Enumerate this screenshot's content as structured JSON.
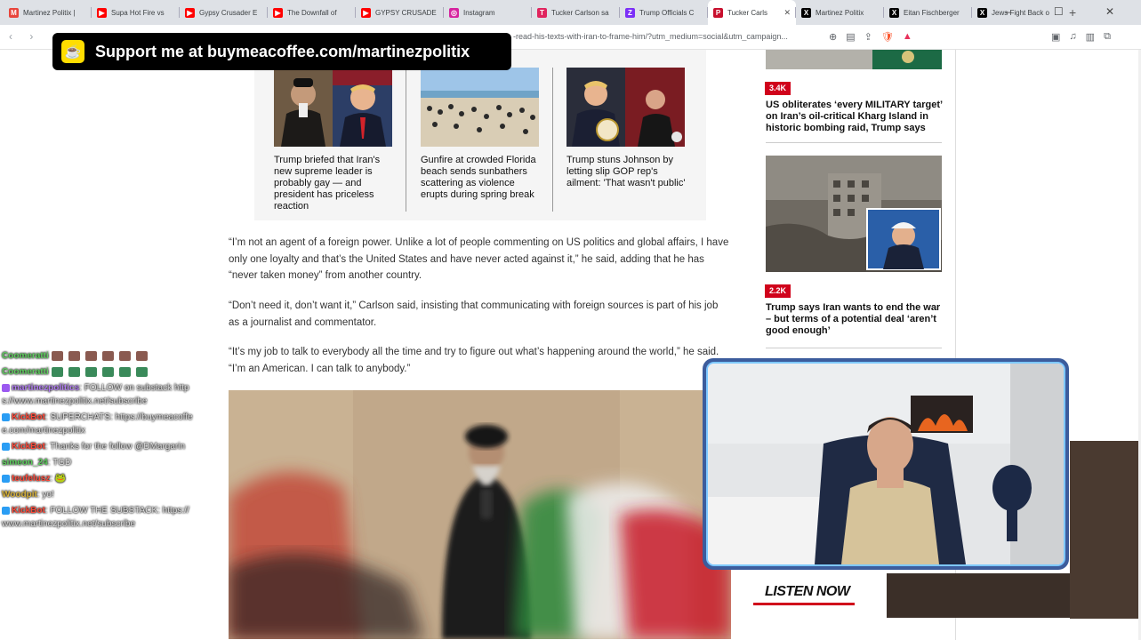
{
  "browser": {
    "tabs": [
      {
        "title": "Martinez Politix |",
        "fav_color": "#e8453c",
        "fav_glyph": "M",
        "active": false
      },
      {
        "title": "Supa Hot Fire vs",
        "fav_color": "#ff0000",
        "fav_glyph": "▶",
        "active": false
      },
      {
        "title": "Gypsy Crusader E",
        "fav_color": "#ff0000",
        "fav_glyph": "▶",
        "active": false
      },
      {
        "title": "The Downfall of",
        "fav_color": "#ff0000",
        "fav_glyph": "▶",
        "active": false
      },
      {
        "title": "GYPSY CRUSADE",
        "fav_color": "#ff0000",
        "fav_glyph": "▶",
        "active": false
      },
      {
        "title": "Instagram",
        "fav_color": "#d6249f",
        "fav_glyph": "◎",
        "active": false
      },
      {
        "title": "Tucker Carlson sa",
        "fav_color": "#e0245e",
        "fav_glyph": "T",
        "active": false
      },
      {
        "title": "Trump Officials C",
        "fav_color": "#7b2ff7",
        "fav_glyph": "Z",
        "active": false
      },
      {
        "title": "Tucker Carls",
        "fav_color": "#c8102e",
        "fav_glyph": "P",
        "active": true
      },
      {
        "title": "Martinez Politix",
        "fav_color": "#000000",
        "fav_glyph": "X",
        "active": false
      },
      {
        "title": "Eitan Fischberger",
        "fav_color": "#000000",
        "fav_glyph": "X",
        "active": false
      },
      {
        "title": "Jews Fight Back o",
        "fav_color": "#000000",
        "fav_glyph": "X",
        "active": false
      }
    ],
    "tab_close_glyph": "✕",
    "new_tab_glyph": "+",
    "address": "-read-his-texts-with-iran-to-frame-him/?utm_medium=social&utm_campaign...",
    "nav_glyphs": "‹ ›",
    "toolbar_icons": [
      "zoom-icon",
      "reader-icon",
      "share-icon",
      "brave-shield-icon",
      "rewards-icon"
    ],
    "toolbar_glyphs": [
      "⊕",
      "▤",
      "⇪",
      "🛡",
      "▲"
    ],
    "right_glyphs": [
      "▣",
      "♫",
      "▥",
      "⧉"
    ]
  },
  "support_banner": {
    "cup_glyph": "☕",
    "text": "Support me at buymeacoffee.com/martinezpolitix"
  },
  "cards": [
    {
      "caption": "Trump briefed that Iran's new supreme leader is probably gay — and president has priceless reaction"
    },
    {
      "caption": "Gunfire at crowded Florida beach sends sunbathers scattering as violence erupts during spring break"
    },
    {
      "caption": "Trump stuns Johnson by letting slip GOP rep's ailment: 'That wasn't public'"
    }
  ],
  "article": {
    "p1": "“I’m not an agent of a foreign power. Unlike a lot of people commenting on US politics and global affairs, I have only one loyalty and that’s the United States and have never acted against it,” he said, adding that he has “never taken money” from another country.",
    "p2": "“Don’t need it, don’t want it,” Carlson said, insisting that communicating with foreign sources is part of his job as a journalist and commentator.",
    "p3": "“It’s my job to talk to everybody all the time and try to figure out what’s happening around the world,” he said. “I’m an American. I can talk to anybody.”"
  },
  "sidebar": {
    "items": [
      {
        "badge": "3.4K",
        "headline": "US obliterates ‘every MILITARY target’ on Iran’s oil-critical Kharg Island in historic bombing raid, Trump says"
      },
      {
        "badge": "2.2K",
        "headline": "Trump says Iran wants to end the war – but terms of a potential deal ‘aren’t good enough’"
      }
    ],
    "listen_now": "LISTEN NOW"
  },
  "chat": [
    {
      "user": "Coomeratti",
      "color_class": "green",
      "text": "",
      "emotes": 6,
      "emote_color": "#8a5a50"
    },
    {
      "user": "Coomeratti",
      "color_class": "green",
      "text": "",
      "emotes": 6,
      "emote_color": "#3a8a5a"
    },
    {
      "user": "martinezpolitics",
      "color_class": "purple",
      "text": ": FOLLOW on substack https://www.martinezpolitix.net/subscribe"
    },
    {
      "user": "KickBot",
      "color_class": "red",
      "text": ": SUPERCHATS: https://buymeacoffee.com/martinezpolitix"
    },
    {
      "user": "KickBot",
      "color_class": "red",
      "text": ": Thanks for the follow @DMargarin"
    },
    {
      "user": "simeon_24",
      "color_class": "green",
      "text": ": TGD"
    },
    {
      "user": "teufelusz",
      "color_class": "red",
      "text": ": 🐸"
    },
    {
      "user": "Woodpit",
      "color_class": "gold",
      "text": ": yo!"
    },
    {
      "user": "KickBot",
      "color_class": "red",
      "text": ": FOLLOW THE SUBSTACK: https://www.martinezpolitix.net/subscribe"
    }
  ]
}
